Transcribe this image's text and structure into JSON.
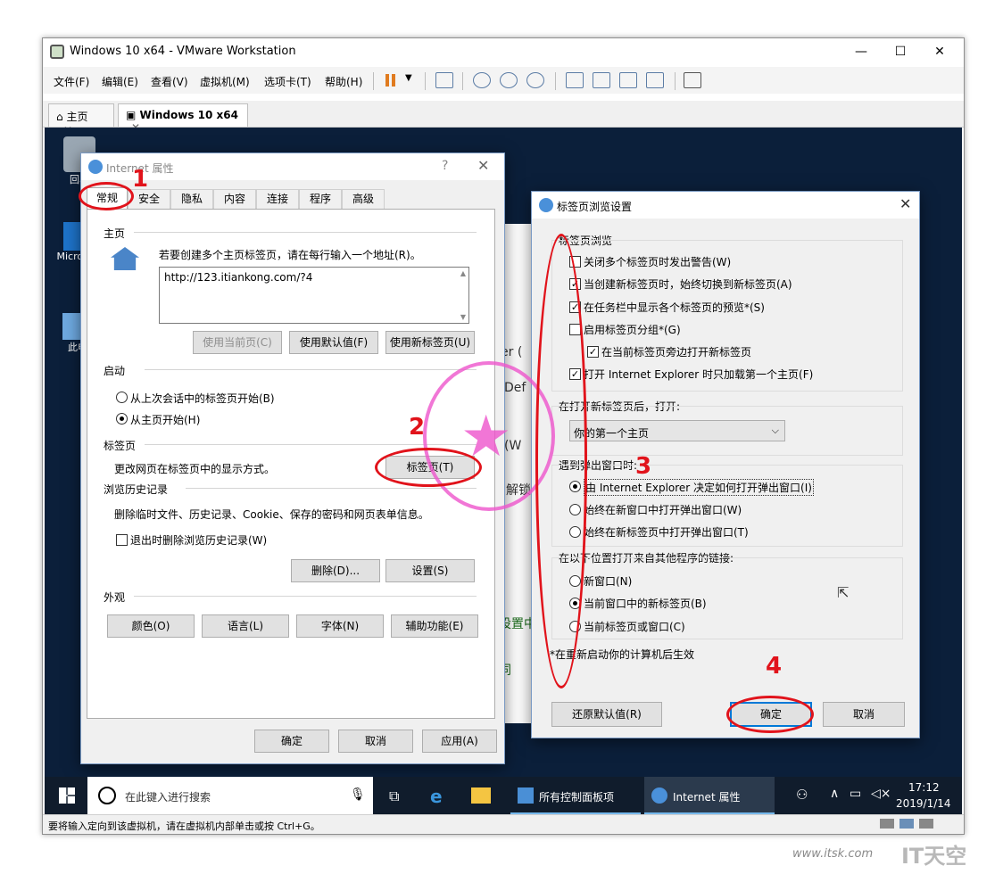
{
  "vmware": {
    "title": "Windows 10 x64 - VMware Workstation",
    "menu": [
      "文件(F)",
      "编辑(E)",
      "查看(V)",
      "虚拟机(M)",
      "选项卡(T)",
      "帮助(H)"
    ],
    "tabs": [
      {
        "label": "主页"
      },
      {
        "label": "Windows 10 x64"
      }
    ],
    "status_text": "要将输入定向到该虚拟机，请在虚拟机内部单击或按 Ctrl+G。"
  },
  "desktop": {
    "icons": [
      "回收",
      "Micro Ed",
      "此电"
    ]
  },
  "internet_props": {
    "title": "Internet 属性",
    "help_glyph": "?",
    "tabs": [
      "常规",
      "安全",
      "隐私",
      "内容",
      "连接",
      "程序",
      "高级"
    ],
    "home": {
      "label": "主页",
      "desc": "若要创建多个主页标签页，请在每行输入一个地址(R)。",
      "url": "http://123.itiankong.com/?4",
      "btn_current": "使用当前页(C)",
      "btn_default": "使用默认值(F)",
      "btn_newtab": "使用新标签页(U)"
    },
    "startup": {
      "label": "启动",
      "opt1": "从上次会话中的标签页开始(B)",
      "opt2": "从主页开始(H)"
    },
    "tabs_section": {
      "label": "标签页",
      "desc": "更改网页在标签页中的显示方式。",
      "btn": "标签页(T)"
    },
    "history": {
      "label": "浏览历史记录",
      "desc": "删除临时文件、历史记录、Cookie、保存的密码和网页表单信息。",
      "checkbox": "退出时删除浏览历史记录(W)",
      "btn_delete": "删除(D)...",
      "btn_settings": "设置(S)"
    },
    "appearance": {
      "label": "外观",
      "btn_colors": "颜色(O)",
      "btn_lang": "语言(L)",
      "btn_fonts": "字体(N)",
      "btn_access": "辅助功能(E)"
    },
    "ok": "确定",
    "cancel": "取消",
    "apply": "应用(A)"
  },
  "tab_settings": {
    "title": "标签页浏览设置",
    "group1": "标签页浏览",
    "checks": [
      {
        "label": "关闭多个标签页时发出警告(W)",
        "checked": false
      },
      {
        "label": "当创建新标签页时，始终切换到新标签页(A)",
        "checked": true
      },
      {
        "label": "在任务栏中显示各个标签页的预览*(S)",
        "checked": true
      },
      {
        "label": "启用标签页分组*(G)",
        "checked": false
      },
      {
        "label": "在当前标签页旁边打开新标签页",
        "checked": true
      },
      {
        "label": "打开 Internet Explorer 时只加载第一个主页(F)",
        "checked": true
      }
    ],
    "group2": "在打开新标签页后，打开:",
    "dropdown_value": "你的第一个主页",
    "group3": "遇到弹出窗口时:",
    "popup_opts": [
      "由 Internet Explorer 决定如何打开弹出窗口(I)",
      "始终在新窗口中打开弹出窗口(W)",
      "始终在新标签页中打开弹出窗口(T)"
    ],
    "group4": "在以下位置打开来自其他程序的链接:",
    "link_opts": [
      "新窗口(N)",
      "当前窗口中的新标签页(B)",
      "当前标签页或窗口(C)"
    ],
    "footnote": "*在重新启动你的计算机后生效",
    "restore": "还原默认值(R)",
    "ok": "确定",
    "cancel": "取消"
  },
  "taskbar": {
    "search_placeholder": "在此键入进行搜索",
    "item_cp": "所有控制面板项",
    "item_ie": "Internet 属性",
    "time": "17:12",
    "date": "2019/1/14"
  },
  "annotations": {
    "n1": "1",
    "n2": "2",
    "n3": "3",
    "n4": "4"
  },
  "background_texts": [
    "er (",
    "Def",
    "原(W",
    "卸解锁",
    "设置中",
    "同"
  ],
  "watermark_text": "www.itsk.com",
  "watermark_logo": "IT天空",
  "colors": {
    "annotation_red": "#e1131b",
    "stamp_pink": "#ee55cc",
    "accent_blue": "#0078d7"
  }
}
